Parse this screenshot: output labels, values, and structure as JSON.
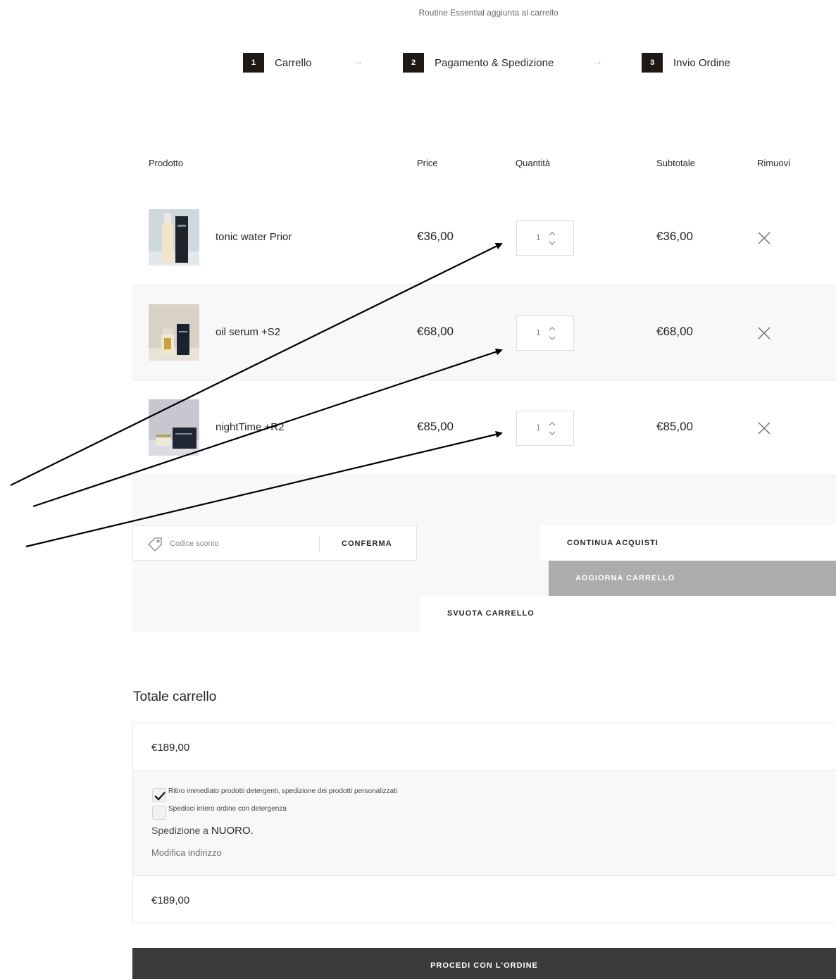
{
  "notice": "Routine Essential aggiunta al carrello",
  "steps": [
    {
      "num": "1",
      "label": "Carrello"
    },
    {
      "num": "2",
      "label": "Pagamento & Spedizione"
    },
    {
      "num": "3",
      "label": "Invio Ordine"
    }
  ],
  "step_separator": "→",
  "columns": {
    "product": "Prodotto",
    "price": "Price",
    "quantity": "Quantità",
    "subtotal": "Subtotale",
    "remove": "Rimuovi"
  },
  "items": [
    {
      "name": "tonic water Prior",
      "price": "€36,00",
      "qty": "1",
      "subtotal": "€36,00"
    },
    {
      "name": "oil serum +S2",
      "price": "€68,00",
      "qty": "1",
      "subtotal": "€68,00"
    },
    {
      "name": "nightTime +R2",
      "price": "€85,00",
      "qty": "1",
      "subtotal": "€85,00"
    }
  ],
  "coupon": {
    "placeholder": "Codice sconto",
    "confirm": "CONFERMA"
  },
  "buttons": {
    "continue": "CONTINUA ACQUISTI",
    "update": "AGGIORNA CARRELLO",
    "empty": "SVUOTA CARRELLO",
    "proceed": "PROCEDI CON L'ORDINE"
  },
  "totals": {
    "title": "Totale carrello",
    "subtotal": "€189,00",
    "option1": "Ritiro immediato prodotti detergenti, spedizione dei prodotti personalizzati",
    "option1_checked": true,
    "option2": "Spedisci intero ordine con detergenza",
    "option2_checked": false,
    "shipping_prefix": "Spedizione a",
    "shipping_city": "NUORO.",
    "edit_address": "Modifica indirizzo",
    "total": "€189,00"
  },
  "colors": {
    "step_badge": "#1f1916",
    "update_button": "#acacaf",
    "proceed_button": "#3b3b3b",
    "row_alt": "#f8f8f8"
  }
}
